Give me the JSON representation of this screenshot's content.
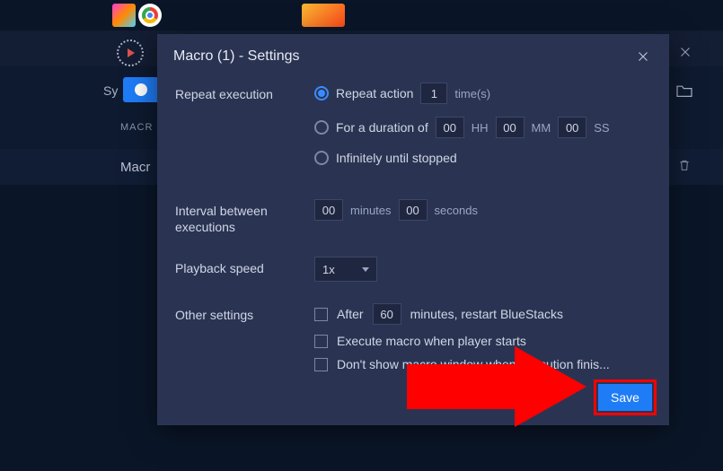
{
  "background": {
    "sync_label_partial": "Sy",
    "macros_tab": "MACR",
    "macro_row_label": "Macr"
  },
  "modal": {
    "title": "Macro (1) - Settings",
    "repeat_execution": {
      "label": "Repeat execution",
      "opt1_label": "Repeat action",
      "opt1_value": "1",
      "opt1_suffix": "time(s)",
      "opt2_label": "For a duration of",
      "opt2_hh": "00",
      "opt2_hh_unit": "HH",
      "opt2_mm": "00",
      "opt2_mm_unit": "MM",
      "opt2_ss": "00",
      "opt2_ss_unit": "SS",
      "opt3_label": "Infinitely until stopped"
    },
    "interval": {
      "label": "Interval between executions",
      "minutes_value": "00",
      "minutes_unit": "minutes",
      "seconds_value": "00",
      "seconds_unit": "seconds"
    },
    "playback": {
      "label": "Playback speed",
      "value": "1x"
    },
    "other": {
      "label": "Other settings",
      "opt1_prefix": "After",
      "opt1_value": "60",
      "opt1_suffix": "minutes, restart BlueStacks",
      "opt2": "Execute macro when player starts",
      "opt3": "Don't show macro window when execution finis..."
    },
    "save": "Save"
  }
}
